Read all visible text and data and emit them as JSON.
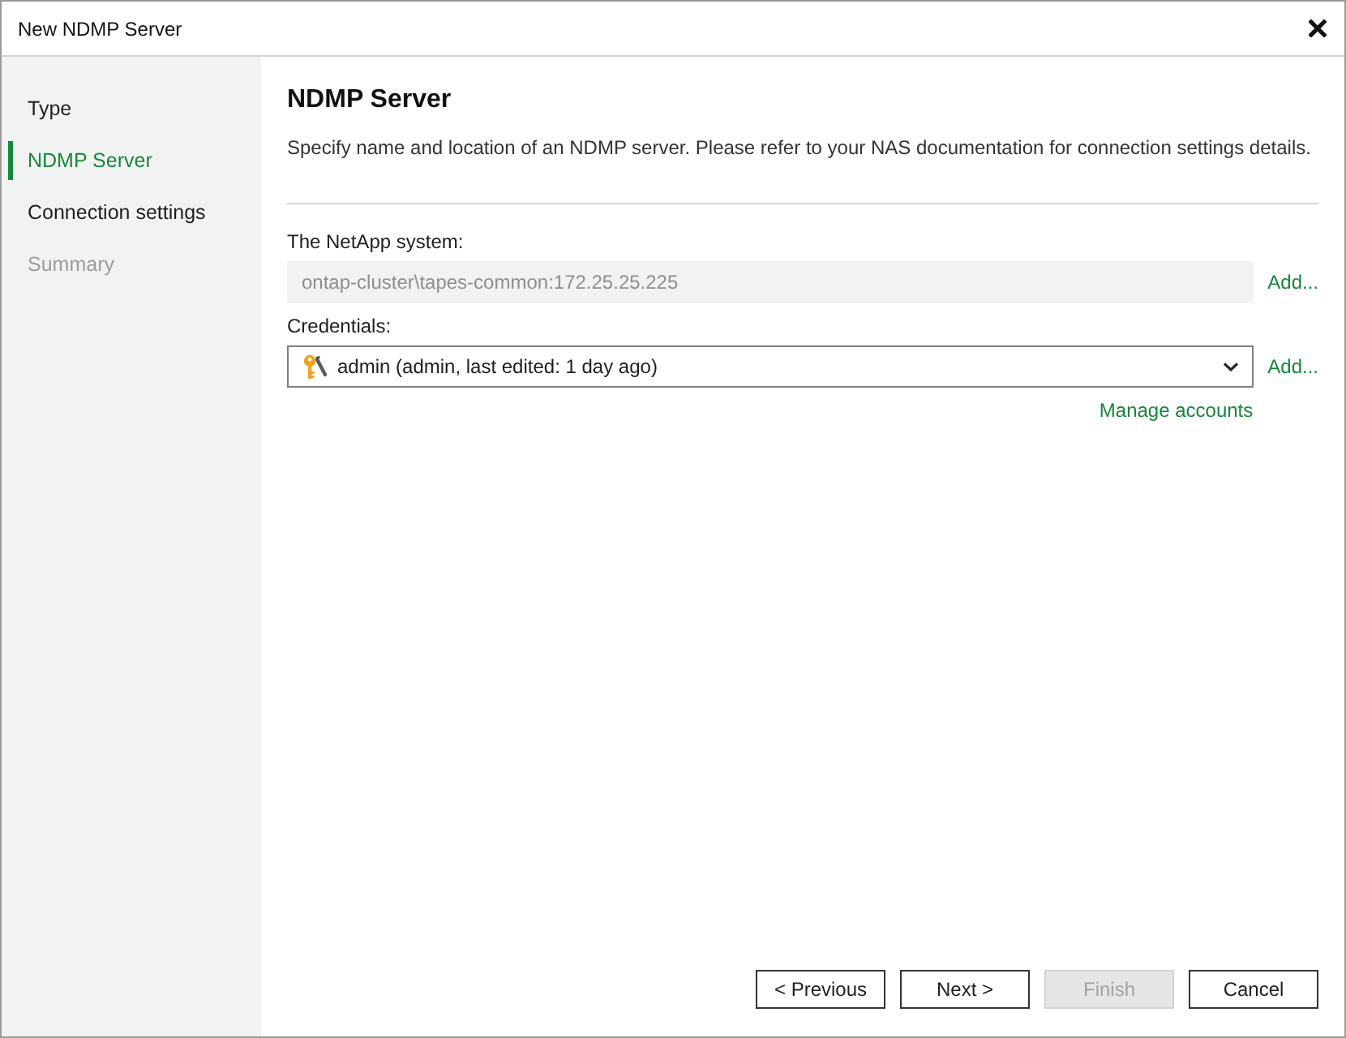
{
  "window": {
    "title": "New NDMP Server"
  },
  "sidebar": {
    "steps": [
      {
        "label": "Type",
        "selected": false,
        "disabled": false
      },
      {
        "label": "NDMP Server",
        "selected": true,
        "disabled": false
      },
      {
        "label": "Connection settings",
        "selected": false,
        "disabled": false
      },
      {
        "label": "Summary",
        "selected": false,
        "disabled": true
      }
    ]
  },
  "page": {
    "title": "NDMP Server",
    "description": "Specify name and location of an NDMP server. Please refer to your NAS documentation for connection settings details."
  },
  "form": {
    "fields": [
      {
        "kind": "text",
        "label": "The NetApp system:",
        "value": "ontap-cluster\\tapes-common:172.25.25.225",
        "disabled": true,
        "link": "Add..."
      },
      {
        "kind": "dropdown",
        "label": "Credentials:",
        "value": "admin (admin, last edited: 1 day ago)",
        "disabled": false,
        "link": "Add...",
        "sublink": "Manage accounts"
      }
    ]
  },
  "buttons": [
    {
      "label": "< Previous",
      "disabled": false
    },
    {
      "label": "Next >",
      "disabled": false
    },
    {
      "label": "Finish",
      "disabled": true
    },
    {
      "label": "Cancel",
      "disabled": false
    }
  ]
}
